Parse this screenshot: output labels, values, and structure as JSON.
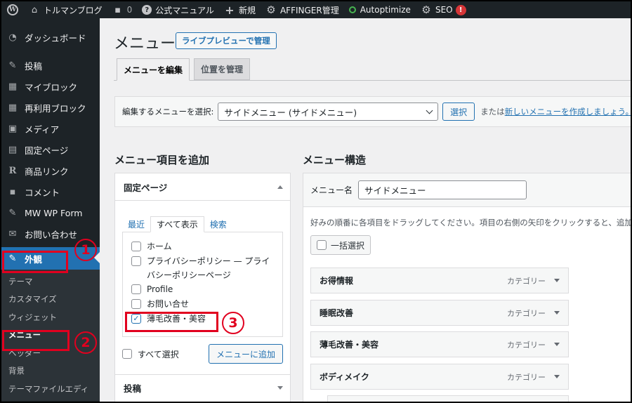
{
  "admin_bar": {
    "site_name": "トルマンブログ",
    "comments_count": "0",
    "manual": "公式マニュアル",
    "new": "新規",
    "affinger": "AFFINGER管理",
    "autoptimize": "Autoptimize",
    "seo": "SEO",
    "seo_badge": "!"
  },
  "sidebar": {
    "items": [
      {
        "label": "ダッシュボード",
        "icon": "dashboard-icon"
      },
      {
        "label": "投稿",
        "icon": "pin-icon"
      },
      {
        "label": "マイブロック",
        "icon": "blocks-icon"
      },
      {
        "label": "再利用ブロック",
        "icon": "blocks-icon"
      },
      {
        "label": "メディア",
        "icon": "media-icon"
      },
      {
        "label": "固定ページ",
        "icon": "page-icon"
      },
      {
        "label": "商品リンク",
        "icon": "r-icon"
      },
      {
        "label": "コメント",
        "icon": "comment-icon"
      },
      {
        "label": "MW WP Form",
        "icon": "pin-icon"
      },
      {
        "label": "お問い合わせ",
        "icon": "mail-icon"
      },
      {
        "label": "外観",
        "icon": "brush-icon"
      }
    ],
    "submenu": [
      "テーマ",
      "カスタマイズ",
      "ウィジェット",
      "メニュー",
      "ヘッダー",
      "背景",
      "テーマファイルエディ"
    ]
  },
  "header": {
    "title": "メニュー",
    "live_preview_button": "ライブプレビューで管理",
    "tabs": [
      "メニューを編集",
      "位置を管理"
    ]
  },
  "select_menu": {
    "label": "編集するメニューを選択:",
    "selected": "サイドメニュー (サイドメニュー)",
    "button": "選択",
    "or": "または",
    "create_link": "新しいメニューを作成しましょう。"
  },
  "add_items": {
    "heading": "メニュー項目を追加",
    "section": "固定ページ",
    "tabs": [
      "最近",
      "すべて表示",
      "検索"
    ],
    "pages": [
      {
        "label": "ホーム",
        "checked": false
      },
      {
        "label": "プライバシーポリシー — プライバシーポリシーページ",
        "checked": false
      },
      {
        "label": "Profile",
        "checked": false
      },
      {
        "label": "お問い合せ",
        "checked": false
      },
      {
        "label": "薄毛改善・美容",
        "checked": true
      }
    ],
    "select_all": "すべて選択",
    "add_button": "メニューに追加",
    "posts_section": "投稿"
  },
  "structure": {
    "heading": "メニュー構造",
    "name_label": "メニュー名",
    "name_value": "サイドメニュー",
    "instructions": "好みの順番に各項目をドラッグしてください。項目の右側の矢印をクリックすると、追加",
    "bulk_select": "一括選択",
    "items": [
      {
        "title": "お得情報",
        "type": "カテゴリー"
      },
      {
        "title": "睡眠改善",
        "type": "カテゴリー"
      },
      {
        "title": "薄毛改善・美容",
        "type": "カテゴリー"
      },
      {
        "title": "ボディメイク",
        "type": "カテゴリー"
      }
    ]
  },
  "annotations": {
    "step1": "1",
    "step2": "2",
    "step3": "3",
    "color": "#e1001f"
  }
}
